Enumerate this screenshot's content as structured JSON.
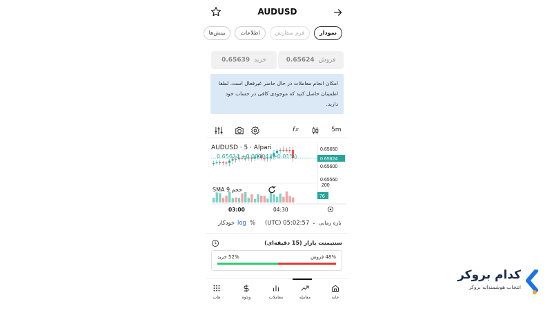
{
  "header": {
    "title": "AUDUSD",
    "star_icon": "star-icon",
    "back_icon": "arrow-right-icon"
  },
  "tabs": [
    {
      "label": "نمودار",
      "state": "active"
    },
    {
      "label": "فرم سفارش",
      "state": "disabled"
    },
    {
      "label": "اطلاعات",
      "state": "normal"
    },
    {
      "label": "بینش‌ها",
      "state": "normal"
    }
  ],
  "prices": {
    "sell_label": "فروش",
    "sell_value": "0.65624",
    "buy_label": "خرید",
    "buy_value": "0.65639"
  },
  "notice": {
    "text": "امکان انجام معاملات در حال حاضر غیرفعال است. لطفا اطمینان حاصل کنید که موجودی کافی در حساب خود دارید."
  },
  "toolbar": {
    "interval": "5m",
    "indicator_symbol": "f𝑥"
  },
  "chart": {
    "symbol_line": "AUDUSD · 5 · Alpari",
    "last_price": "0.65624",
    "change": "+0.00004 (+0.01%)",
    "indicator_label": "حجم 9 SMA",
    "volume_last": "76",
    "volume_axis": "200"
  },
  "chart_data": {
    "type": "candlestick",
    "price_axis_ticks": [
      "0.65650",
      "0.65600",
      "0.65560"
    ],
    "highlight_price": "0.65624",
    "time_ticks": [
      "03:00",
      "04:30"
    ],
    "volume_axis_tick": "200",
    "volume_last": "76"
  },
  "controls": {
    "timeframe_label": "بازه زمانی",
    "clock": "(UTC) 05:02:57",
    "percent": "%",
    "log": "log",
    "auto": "خودکار"
  },
  "sentiment": {
    "title": "سنتیمنت بازار (15 دقیقه‌ای)",
    "sell_label": "48% فروش",
    "buy_label": "52% خرید",
    "sell_pct": 48,
    "buy_pct": 52,
    "sell_color": "#e53935",
    "buy_color": "#2ecc71"
  },
  "nav": [
    {
      "label": "خانه",
      "icon": "home-icon"
    },
    {
      "label": "معامله",
      "icon": "trend-icon"
    },
    {
      "label": "معاملات",
      "icon": "bar-chart-icon"
    },
    {
      "label": "وجوه",
      "icon": "dollar-icon"
    },
    {
      "label": "هاب",
      "icon": "grid-icon"
    }
  ],
  "brand": {
    "name": "کدام بروکر",
    "tagline": "انتخاب هوشمندانه بروکر",
    "primary_color": "#1a73e8",
    "accent_color": "#f5a623"
  }
}
